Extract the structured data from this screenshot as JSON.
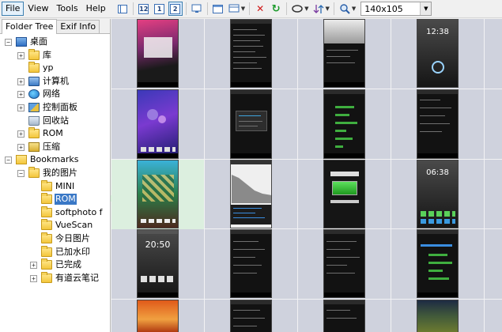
{
  "menu": [
    {
      "label": "File",
      "active": true
    },
    {
      "label": "View",
      "active": false
    },
    {
      "label": "Tools",
      "active": false
    },
    {
      "label": "Help",
      "active": false
    }
  ],
  "toolbar": {
    "view_buttons": [
      "12",
      "1",
      "2"
    ],
    "thumb_size": "140x105"
  },
  "tabs": [
    {
      "label": "Folder Tree",
      "active": true
    },
    {
      "label": "Exif Info",
      "active": false
    }
  ],
  "tree": [
    {
      "id": "desktop",
      "label": "桌面",
      "level": 0,
      "expander": "-",
      "icon": "desktop-icon"
    },
    {
      "id": "lib",
      "label": "库",
      "level": 1,
      "expander": "+",
      "icon": "library-folder-icon"
    },
    {
      "id": "yp",
      "label": "yp",
      "level": 1,
      "expander": "",
      "icon": "user-folder-icon"
    },
    {
      "id": "computer",
      "label": "计算机",
      "level": 1,
      "expander": "+",
      "icon": "computer-icon"
    },
    {
      "id": "network",
      "label": "网络",
      "level": 1,
      "expander": "+",
      "icon": "network-icon"
    },
    {
      "id": "control",
      "label": "控制面板",
      "level": 1,
      "expander": "+",
      "icon": "control-panel-icon"
    },
    {
      "id": "recycle",
      "label": "回收站",
      "level": 1,
      "expander": "",
      "icon": "recycle-bin-icon"
    },
    {
      "id": "rom1",
      "label": "ROM",
      "level": 1,
      "expander": "+",
      "icon": "folder-icon"
    },
    {
      "id": "zip",
      "label": "压缩",
      "level": 1,
      "expander": "+",
      "icon": "zip-folder-icon"
    },
    {
      "id": "bookmarks",
      "label": "Bookmarks",
      "level": 0,
      "expander": "-",
      "icon": "bookmark-folder-icon"
    },
    {
      "id": "mypics",
      "label": "我的图片",
      "level": 1,
      "expander": "-",
      "icon": "folder-icon"
    },
    {
      "id": "mini",
      "label": "MINI",
      "level": 2,
      "expander": "",
      "icon": "folder-icon"
    },
    {
      "id": "rom2",
      "label": "ROM",
      "level": 2,
      "expander": "",
      "icon": "folder-icon",
      "selected": true
    },
    {
      "id": "softphoto",
      "label": "softphoto f",
      "level": 2,
      "expander": "",
      "icon": "folder-icon"
    },
    {
      "id": "vuescan",
      "label": "VueScan",
      "level": 2,
      "expander": "",
      "icon": "folder-icon"
    },
    {
      "id": "today",
      "label": "今日图片",
      "level": 2,
      "expander": "",
      "icon": "folder-icon"
    },
    {
      "id": "watermark",
      "label": "已加水印",
      "level": 2,
      "expander": "",
      "icon": "folder-icon"
    },
    {
      "id": "done",
      "label": "已完成",
      "level": 2,
      "expander": "+",
      "icon": "folder-icon"
    },
    {
      "id": "youdao",
      "label": "有道云笔记",
      "level": 2,
      "expander": "+",
      "icon": "folder-icon"
    }
  ],
  "thumbnails": {
    "lock_time": "20:50",
    "clock_time_1": "12:38",
    "clock_time_2": "06:38"
  }
}
